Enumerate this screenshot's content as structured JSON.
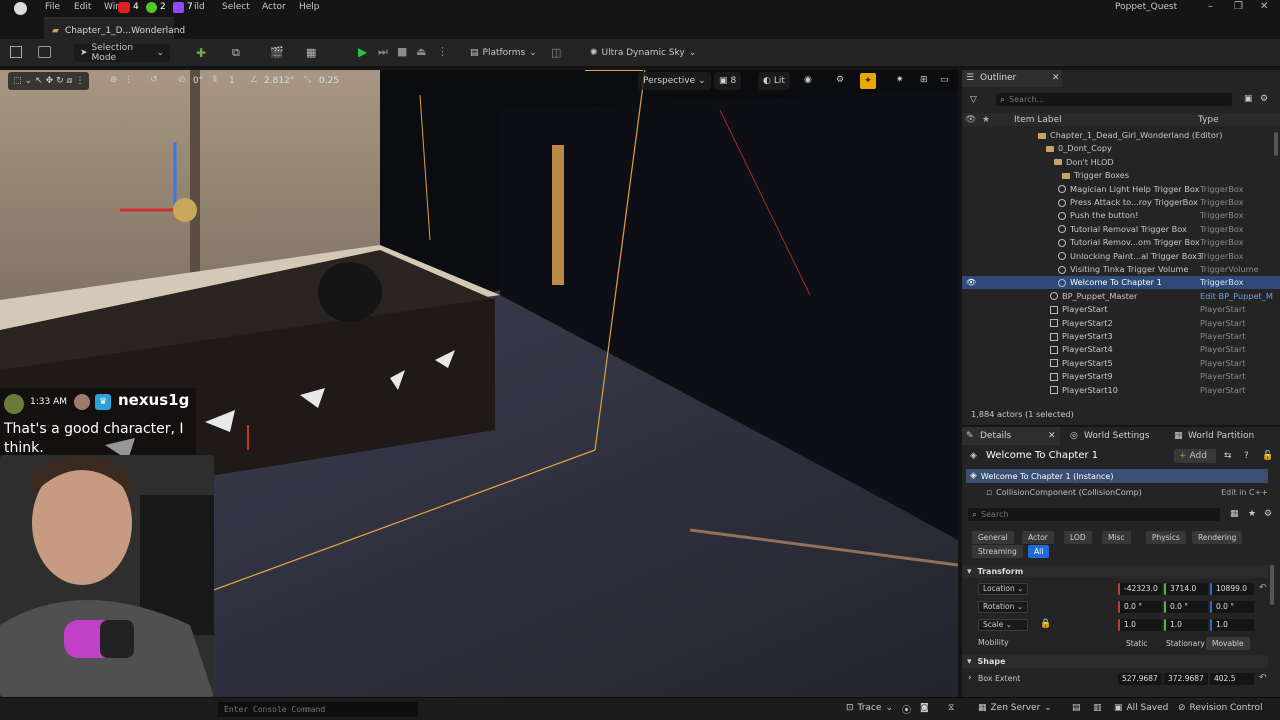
{
  "app": {
    "project_name": "Poppet_Quest",
    "document_tab": "Chapter_1_D...Wonderland"
  },
  "menu": {
    "items": [
      "File",
      "Edit",
      "Win",
      "4",
      "2",
      "7",
      "ild",
      "Select",
      "Actor",
      "Help"
    ]
  },
  "toolbar": {
    "selection_mode": "Selection Mode",
    "platforms": "Platforms",
    "sky": "Ultra Dynamic Sky"
  },
  "viewport": {
    "grid_angle": "0°",
    "snap_count": "1",
    "scale_snap": "2.812°",
    "camera_speed_value": "0.25",
    "perspective": "Perspective",
    "fov_count": "8",
    "lit": "Lit"
  },
  "stream": {
    "time": "1:33 AM",
    "username": "nexus1g",
    "message": "That's a good character, I think."
  },
  "outliner": {
    "tab": "Outliner",
    "search_placeholder": "Search...",
    "col_label": "Item Label",
    "col_type": "Type",
    "rows": [
      {
        "label": "Chapter_1_Dead_Girl_Wonderland (Editor)",
        "type": "",
        "kind": "root"
      },
      {
        "label": "0_Dont_Copy",
        "type": "",
        "kind": "folder"
      },
      {
        "label": "Don't HLOD",
        "type": "",
        "kind": "folder"
      },
      {
        "label": "Trigger Boxes",
        "type": "",
        "kind": "folder"
      },
      {
        "label": "Magician Light Help Trigger Box",
        "type": "TriggerBox",
        "kind": "actor"
      },
      {
        "label": "Press Attack to...roy TriggerBox",
        "type": "TriggerBox",
        "kind": "actor"
      },
      {
        "label": "Push the button!",
        "type": "TriggerBox",
        "kind": "actor"
      },
      {
        "label": "Tutorial Removal Trigger Box",
        "type": "TriggerBox",
        "kind": "actor"
      },
      {
        "label": "Tutorial Remov...om Trigger Box",
        "type": "TriggerBox",
        "kind": "actor"
      },
      {
        "label": "Unlocking Paint...al Trigger Box3",
        "type": "TriggerBox",
        "kind": "actor"
      },
      {
        "label": "Visiting Tinka Trigger Volume",
        "type": "TriggerVolume",
        "kind": "actor"
      },
      {
        "label": "Welcome To Chapter 1",
        "type": "TriggerBox",
        "kind": "actor",
        "selected": true
      },
      {
        "label": "BP_Puppet_Master",
        "type": "Edit BP_Puppet_M",
        "kind": "bp"
      },
      {
        "label": "PlayerStart",
        "type": "PlayerStart",
        "kind": "pstart"
      },
      {
        "label": "PlayerStart2",
        "type": "PlayerStart",
        "kind": "pstart"
      },
      {
        "label": "PlayerStart3",
        "type": "PlayerStart",
        "kind": "pstart"
      },
      {
        "label": "PlayerStart4",
        "type": "PlayerStart",
        "kind": "pstart"
      },
      {
        "label": "PlayerStart5",
        "type": "PlayerStart",
        "kind": "pstart"
      },
      {
        "label": "PlayerStart9",
        "type": "PlayerStart",
        "kind": "pstart"
      },
      {
        "label": "PlayerStart10",
        "type": "PlayerStart",
        "kind": "pstart"
      }
    ],
    "status": "1,884 actors (1 selected)"
  },
  "details": {
    "tab_details": "Details",
    "tab_world_settings": "World Settings",
    "tab_world_partition": "World Partition",
    "actor_name": "Welcome To Chapter 1",
    "add_label": "Add",
    "instance_label": "Welcome To Chapter 1 (Instance)",
    "component_label": "CollisionComponent (CollisionComp)",
    "edit_cpp": "Edit in C++",
    "search_placeholder": "Search",
    "categories": [
      "General",
      "Actor",
      "LOD",
      "Misc",
      "Physics",
      "Rendering",
      "Streaming",
      "All"
    ],
    "active_category": "All",
    "transform_header": "Transform",
    "location_label": "Location",
    "location": [
      "-42323.0",
      "3714.0",
      "10899.0"
    ],
    "rotation_label": "Rotation",
    "rotation": [
      "0.0 °",
      "0.0 °",
      "0.0 °"
    ],
    "scale_label": "Scale",
    "scale": [
      "1.0",
      "1.0",
      "1.0"
    ],
    "mobility_label": "Mobility",
    "mobility_options": [
      "Static",
      "Stationary",
      "Movable"
    ],
    "mobility_selected": "Movable",
    "shape_header": "Shape",
    "box_extent_label": "Box Extent",
    "box_extent": [
      "527.9687",
      "372.9687",
      "402.5"
    ]
  },
  "statusbar": {
    "console_placeholder": "Enter Console Command",
    "trace": "Trace",
    "zen_server": "Zen Server",
    "all_saved": "All Saved",
    "revision_control": "Revision Control"
  },
  "colors": {
    "accent_blue": "#2d4a78",
    "play_green": "#27c241",
    "active_tab_blue": "#1f6ad4"
  }
}
